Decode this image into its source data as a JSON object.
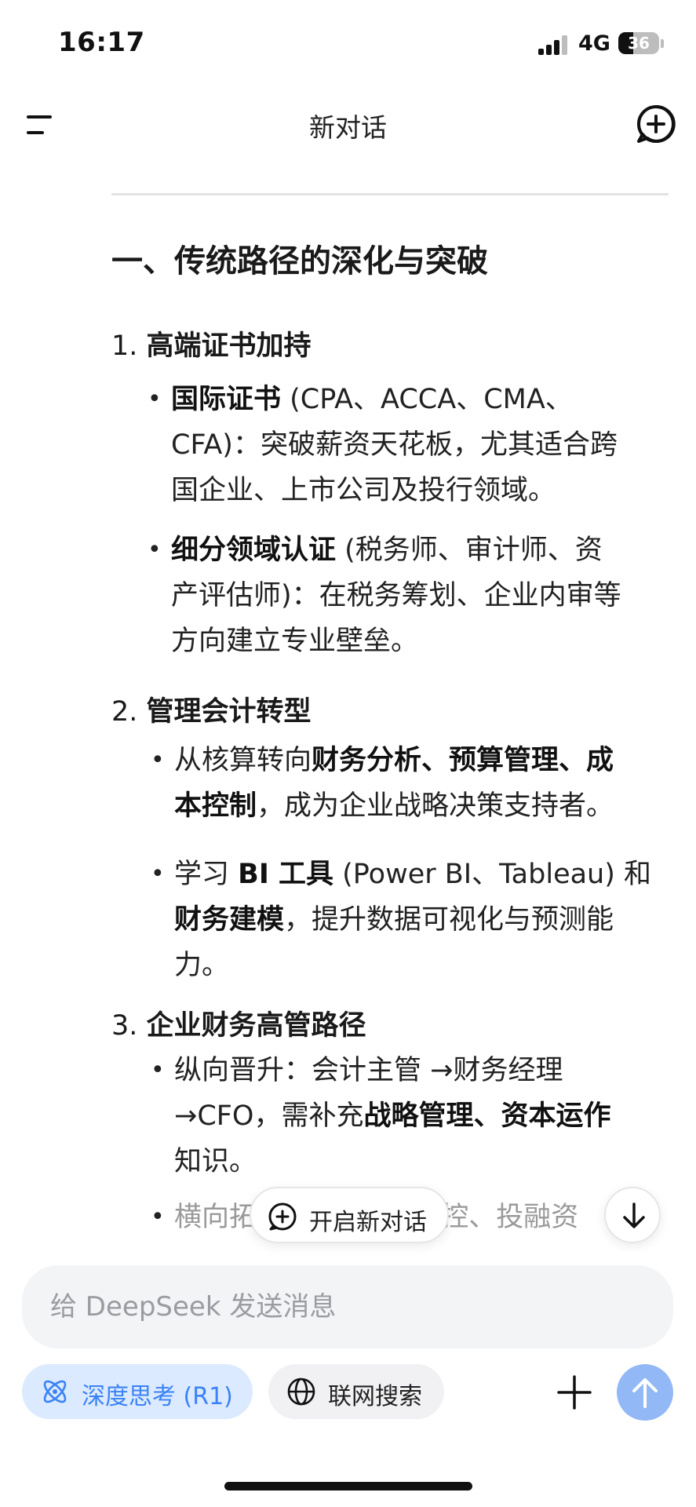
{
  "status": {
    "time": "16:17",
    "network": "4G",
    "battery": "36",
    "battery_level": 0.36
  },
  "nav": {
    "title": "新对话"
  },
  "content": {
    "heading": "一、传统路径的深化与突破",
    "items": [
      {
        "num": "1.",
        "title": "高端证书加持",
        "bullets": [
          {
            "lines": [
              [
                {
                  "t": "国际证书",
                  "b": true
                },
                {
                  "t": " (CPA、ACCA、CMA、",
                  "b": false
                }
              ],
              [
                {
                  "t": "CFA)：突破薪资天花板，尤其适合跨",
                  "b": false
                }
              ],
              [
                {
                  "t": "国企业、上市公司及投行领域。",
                  "b": false
                }
              ]
            ]
          },
          {
            "lines": [
              [
                {
                  "t": "细分领域认证",
                  "b": true
                },
                {
                  "t": " (税务师、审计师、资",
                  "b": false
                }
              ],
              [
                {
                  "t": "产评估师)：在税务筹划、企业内审等",
                  "b": false
                }
              ],
              [
                {
                  "t": "方向建立专业壁垒。",
                  "b": false
                }
              ]
            ]
          }
        ]
      },
      {
        "num": "2.",
        "title": "管理会计转型",
        "bullets": [
          {
            "lines": [
              [
                {
                  "t": "从核算转向",
                  "b": false
                },
                {
                  "t": "财务分析、预算管理、成",
                  "b": true
                }
              ],
              [
                {
                  "t": "本控制",
                  "b": true
                },
                {
                  "t": "，成为企业战略决策支持者。",
                  "b": false
                }
              ]
            ]
          },
          {
            "lines": [
              [
                {
                  "t": "学习 ",
                  "b": false
                },
                {
                  "t": "BI 工具",
                  "b": true
                },
                {
                  "t": " (Power BI、Tableau) 和",
                  "b": false
                }
              ],
              [
                {
                  "t": "财务建模",
                  "b": true
                },
                {
                  "t": "，提升数据可视化与预测能",
                  "b": false
                }
              ],
              [
                {
                  "t": "力。",
                  "b": false
                }
              ]
            ]
          }
        ]
      },
      {
        "num": "3.",
        "title": "企业财务高管路径",
        "bullets": [
          {
            "lines": [
              [
                {
                  "t": "纵向晋升：会计主管 →财务经理",
                  "b": false
                }
              ],
              [
                {
                  "t": "→CFO，需补充",
                  "b": false
                },
                {
                  "t": "战略管理、资本运作",
                  "b": true
                }
              ],
              [
                {
                  "t": "知识。",
                  "b": false
                }
              ]
            ]
          },
          {
            "lines": [
              [
                {
                  "t": "横向拓",
                  "b": false
                },
                {
                  "t": "                  ",
                  "b": false
                },
                {
                  "t": "内控、投融资",
                  "b": false
                }
              ]
            ]
          }
        ]
      }
    ]
  },
  "floating": {
    "new_chat_label": "开启新对话"
  },
  "input": {
    "placeholder": "给 DeepSeek 发送消息"
  },
  "toolbar": {
    "deep_think_label": "深度思考 (R1)",
    "web_search_label": "联网搜索"
  },
  "colors": {
    "accent": "#3b82f6",
    "accent_bg": "#dbeafe",
    "send_bg": "#93b8f6"
  }
}
